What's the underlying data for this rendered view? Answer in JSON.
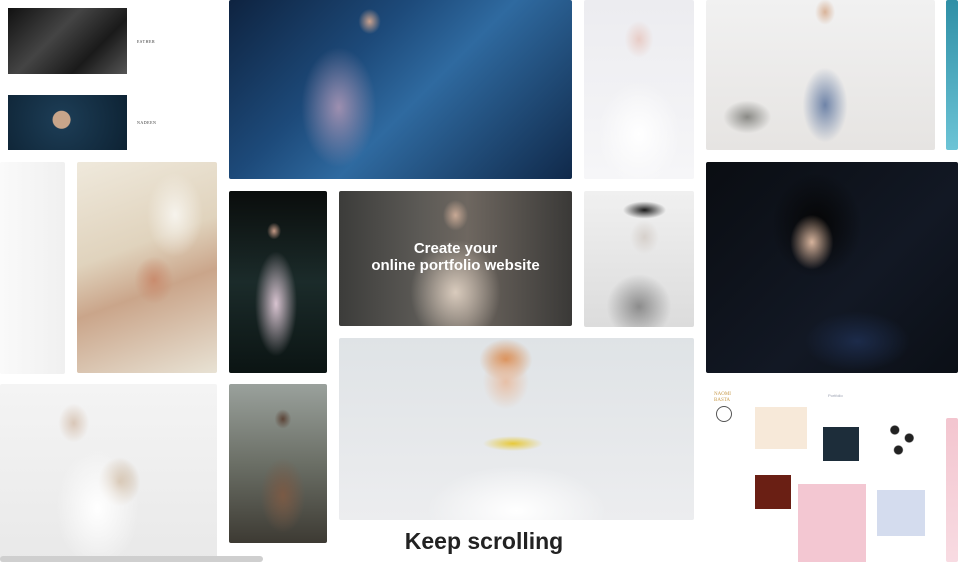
{
  "hero": {
    "line1": "Create your",
    "line2": "online portfolio website"
  },
  "footer": {
    "keep_scrolling": "Keep scrolling"
  },
  "mini_site_left": {
    "item1": "ESTHER",
    "item2": "NADEEN"
  },
  "mini_site_right": {
    "brand": "NAOMI BASTA",
    "menu": "Portfolio"
  }
}
